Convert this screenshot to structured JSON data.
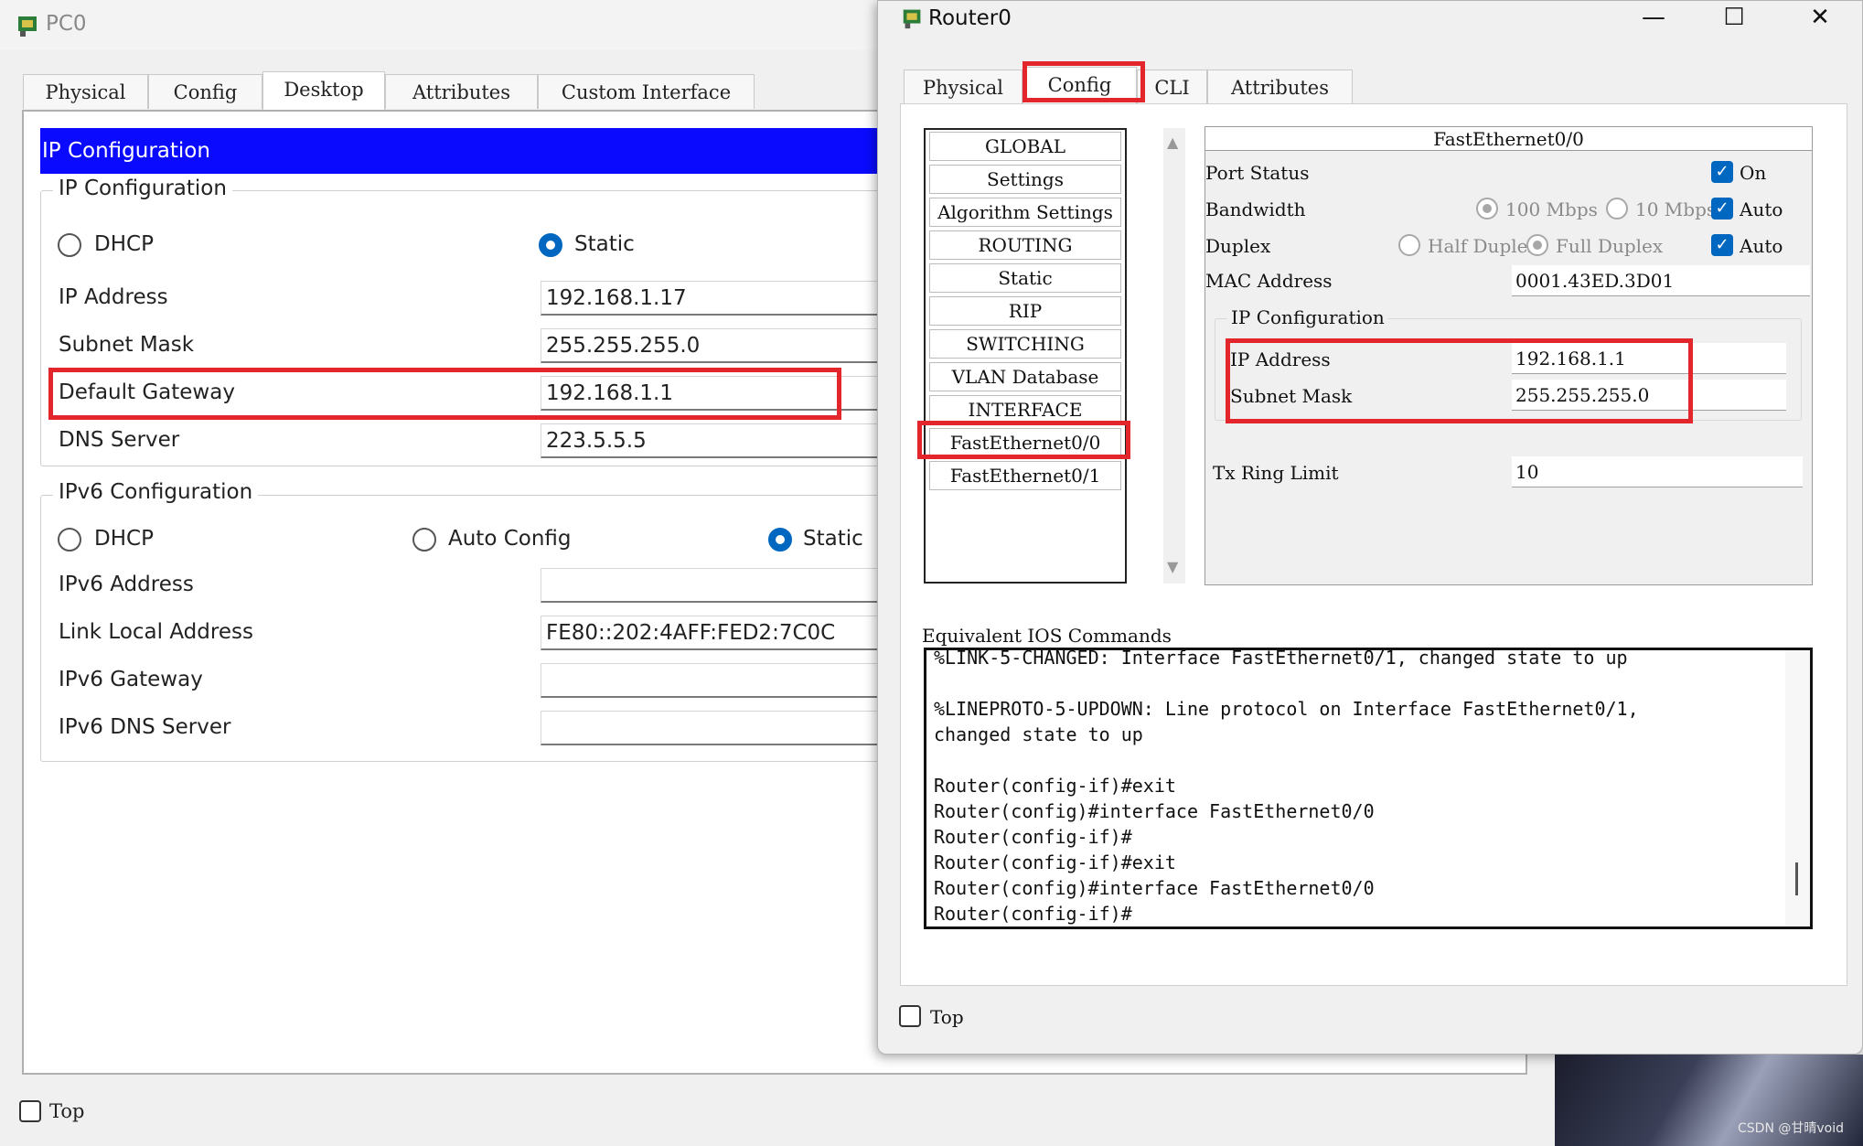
{
  "pc0": {
    "title": "PC0",
    "tabs": [
      "Physical",
      "Config",
      "Desktop",
      "Attributes",
      "Custom Interface"
    ],
    "section_header": "IP Configuration",
    "ipv4": {
      "legend": "IP Configuration",
      "dhcp_label": "DHCP",
      "static_label": "Static",
      "mode": "Static",
      "ip_label": "IP Address",
      "ip_value": "192.168.1.17",
      "mask_label": "Subnet Mask",
      "mask_value": "255.255.255.0",
      "gateway_label": "Default Gateway",
      "gateway_value": "192.168.1.1",
      "dns_label": "DNS Server",
      "dns_value": "223.5.5.5"
    },
    "ipv6": {
      "legend": "IPv6 Configuration",
      "dhcp_label": "DHCP",
      "auto_label": "Auto Config",
      "static_label": "Static",
      "mode": "Static",
      "address_label": "IPv6 Address",
      "address_value": "",
      "link_local_label": "Link Local Address",
      "link_local_value": "FE80::202:4AFF:FED2:7C0C",
      "gateway_label": "IPv6 Gateway",
      "gateway_value": "",
      "dns_label": "IPv6 DNS Server",
      "dns_value": ""
    },
    "top_label": "Top"
  },
  "router": {
    "title": "Router0",
    "controls": {
      "minimize": "—",
      "maximize": "☐",
      "close": "✕"
    },
    "tabs": [
      "Physical",
      "Config",
      "CLI",
      "Attributes"
    ],
    "active_tab": "Config",
    "nav_items": [
      "GLOBAL",
      "Settings",
      "Algorithm Settings",
      "ROUTING",
      "Static",
      "RIP",
      "SWITCHING",
      "VLAN Database",
      "INTERFACE",
      "FastEthernet0/0",
      "FastEthernet0/1"
    ],
    "selected_nav": "FastEthernet0/0",
    "port": {
      "header": "FastEthernet0/0",
      "port_status_label": "Port Status",
      "on_label": "On",
      "bandwidth_label": "Bandwidth",
      "bw_100": "100 Mbps",
      "bw_10": "10 Mbps",
      "auto_label": "Auto",
      "duplex_label": "Duplex",
      "half_duplex": "Half Duplex",
      "full_duplex": "Full Duplex",
      "mac_label": "MAC Address",
      "mac_value": "0001.43ED.3D01",
      "ip_config_legend": "IP Configuration",
      "ip_label": "IP Address",
      "ip_value": "192.168.1.1",
      "mask_label": "Subnet Mask",
      "mask_value": "255.255.255.0",
      "tx_label": "Tx Ring Limit",
      "tx_value": "10"
    },
    "ios_label": "Equivalent IOS Commands",
    "ios_lines": [
      "%LINK-5-CHANGED: Interface FastEthernet0/1, changed state to up",
      "",
      "%LINEPROTO-5-UPDOWN: Line protocol on Interface FastEthernet0/1,",
      "changed state to up",
      "",
      "Router(config-if)#exit",
      "Router(config)#interface FastEthernet0/0",
      "Router(config-if)#",
      "Router(config-if)#exit",
      "Router(config)#interface FastEthernet0/0",
      "Router(config-if)#"
    ],
    "top_label": "Top"
  },
  "watermark": "CSDN @甘晴void",
  "colors": {
    "header_blue": "#0a0aff",
    "highlight_red": "#e3262c",
    "check_blue": "#0067c0"
  }
}
